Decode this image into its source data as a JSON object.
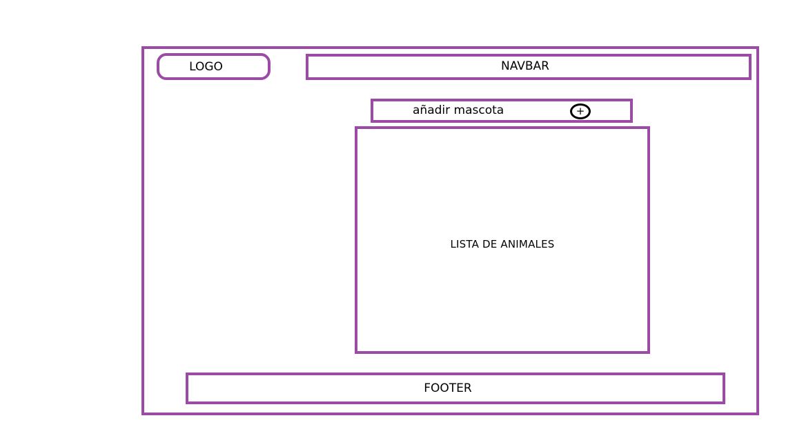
{
  "colors": {
    "outline": "#9b4ba6",
    "icon_outline": "#000000"
  },
  "logo": {
    "label": "LOGO"
  },
  "navbar": {
    "label": "NAVBAR"
  },
  "add_pet": {
    "label": "añadir mascota",
    "icon": "plus-circle-icon",
    "icon_glyph": "+"
  },
  "animal_list": {
    "label": "LISTA DE ANIMALES"
  },
  "footer": {
    "label": "FOOTER"
  }
}
